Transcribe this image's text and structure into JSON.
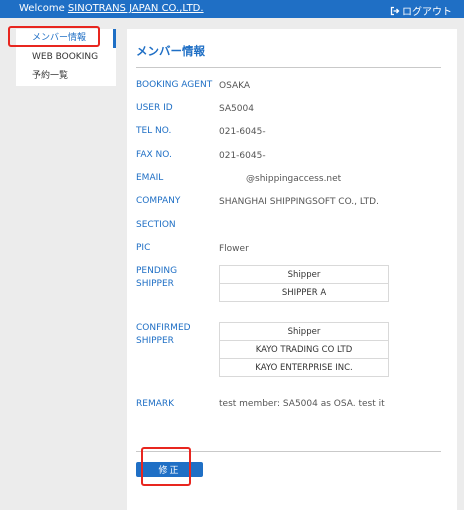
{
  "header": {
    "welcome_prefix": "Welcome ",
    "company": "SINOTRANS JAPAN CO.,LTD.",
    "logout": "ログアウト"
  },
  "sidebar": {
    "items": [
      {
        "label": "メンバー情報"
      },
      {
        "label": "WEB BOOKING"
      },
      {
        "label": "予約一覧"
      }
    ]
  },
  "main": {
    "title": "メンバー情報",
    "fields": {
      "booking_agent": {
        "label": "BOOKING AGENT",
        "value": "OSAKA"
      },
      "user_id": {
        "label": "USER ID",
        "value": "SA5004"
      },
      "tel": {
        "label": "TEL NO.",
        "value": "021-6045-"
      },
      "fax": {
        "label": "FAX NO.",
        "value": "021-6045-"
      },
      "email": {
        "label": "EMAIL",
        "value": "@shippingaccess.net"
      },
      "company": {
        "label": "COMPANY",
        "value": "SHANGHAI SHIPPINGSOFT CO., LTD."
      },
      "section": {
        "label": "SECTION",
        "value": ""
      },
      "pic": {
        "label": "PIC",
        "value": "Flower"
      },
      "pending": {
        "label_line1": "PENDING",
        "label_line2": "SHIPPER",
        "header": "Shipper",
        "rows": [
          "SHIPPER A"
        ]
      },
      "confirmed": {
        "label_line1": "CONFIRMED",
        "label_line2": "SHIPPER",
        "header": "Shipper",
        "rows": [
          "KAYO TRADING CO LTD",
          "KAYO ENTERPRISE INC."
        ]
      },
      "remark": {
        "label": "REMARK",
        "value": "test member: SA5004 as OSA. test it"
      }
    },
    "edit_button": "修正"
  },
  "colors": {
    "accent": "#1f6fc5",
    "highlight": "#e8261f"
  }
}
